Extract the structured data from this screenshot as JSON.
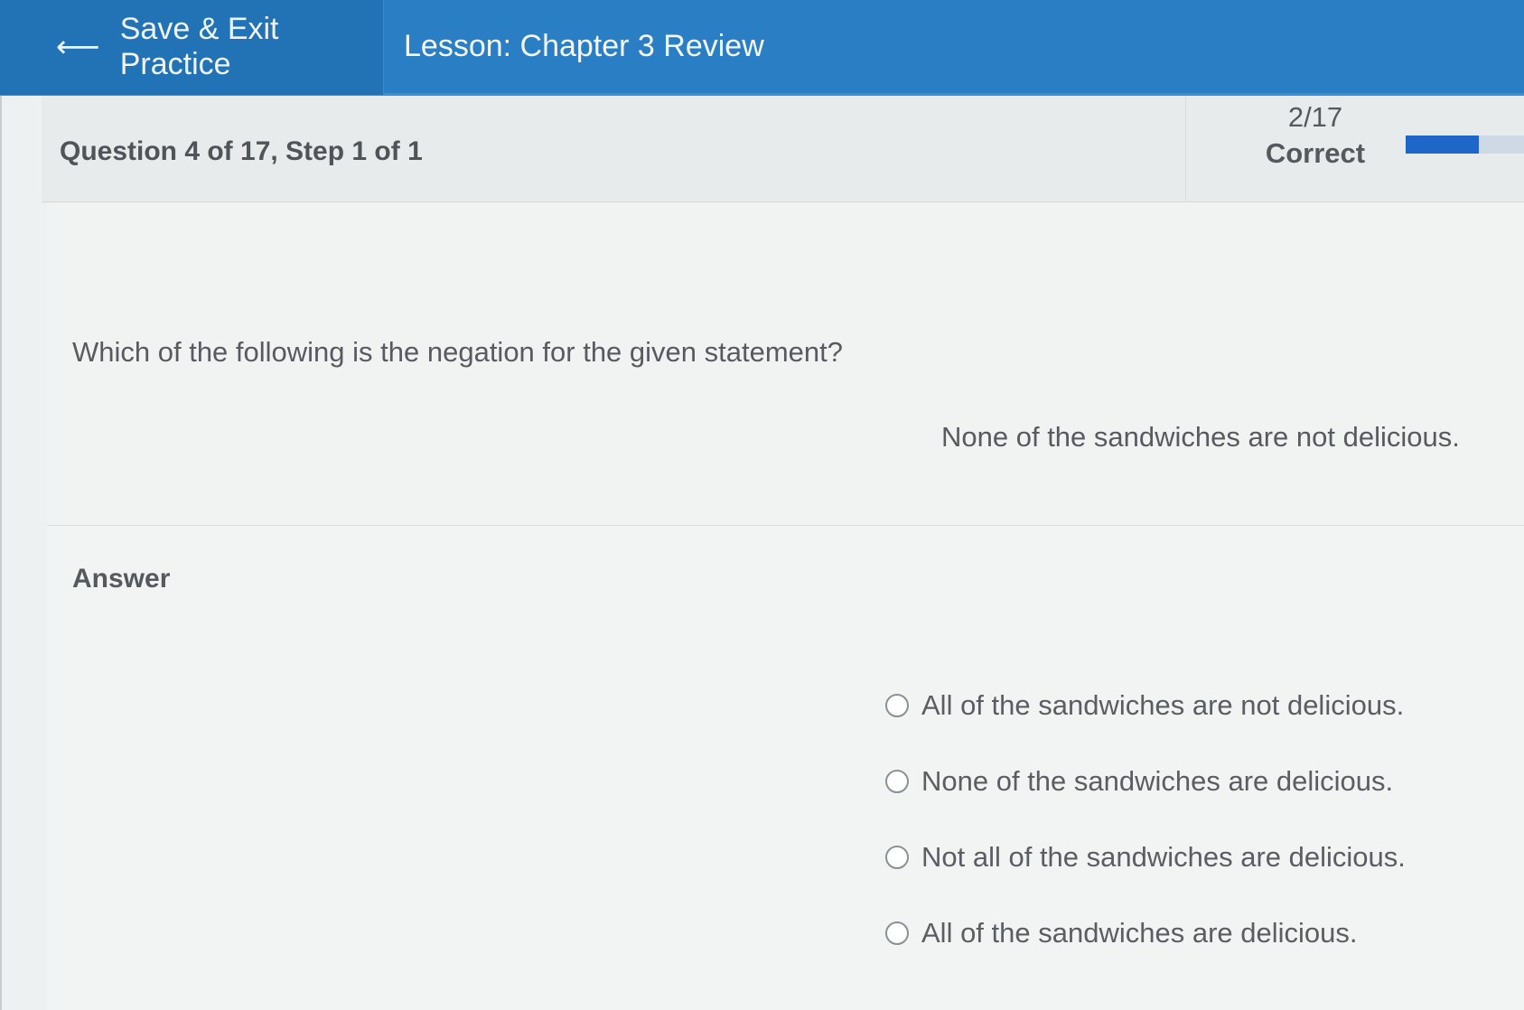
{
  "header": {
    "exit_label": "Save & Exit Practice",
    "lesson_title": "Lesson: Chapter 3 Review"
  },
  "progress": {
    "question_info": "Question 4 of 17,  Step 1 of 1",
    "score_value": "2/17",
    "score_label": "Correct",
    "fraction_complete": 0.45
  },
  "question": {
    "prompt": "Which of the following is the negation for the given statement?",
    "statement": "None of the sandwiches are not delicious."
  },
  "answer": {
    "label": "Answer",
    "options": [
      "All of the sandwiches are not delicious.",
      "None of the sandwiches are delicious.",
      "Not all of the sandwiches are delicious.",
      "All of the sandwiches are delicious."
    ]
  },
  "colors": {
    "header_bg": "#2a7fc4",
    "progress_fill": "#1f66c9"
  }
}
